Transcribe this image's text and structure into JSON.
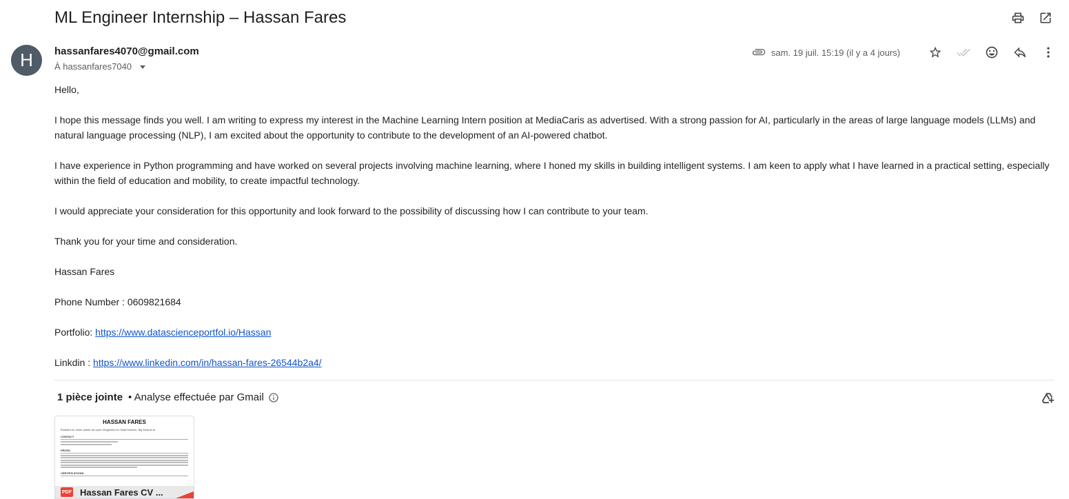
{
  "email": {
    "subject": "ML Engineer Internship – Hassan Fares",
    "avatar_letter": "H",
    "sender": "hassanfares4070@gmail.com",
    "recipient": "À hassanfares7040",
    "date": "sam. 19 juil. 15:19 (il y a 4 jours)",
    "body": {
      "greeting": "Hello,",
      "p1": "I hope this message finds you well. I am writing to express my interest in the Machine Learning Intern position at MediaCaris as advertised. With a strong passion for AI, particularly in the areas of large language models (LLMs) and natural language processing (NLP), I am excited about the opportunity to contribute to the development of an AI-powered chatbot.",
      "p2": "I have experience in Python programming and have worked on several projects involving machine learning, where I honed my skills in building intelligent systems. I am keen to apply what I have learned in a practical setting, especially within the field of education and mobility, to create impactful technology.",
      "p3": "I would appreciate your consideration for this opportunity and look forward to the possibility of discussing how I can contribute to your team.",
      "p4": "Thank you for your time and consideration.",
      "name": "Hassan Fares",
      "phone": "Phone Number : 0609821684",
      "portfolio_label": "Portfolio: ",
      "portfolio_url": "https://www.datascienceportfol.io/Hassan",
      "linkedin_label": "Linkdin : ",
      "linkedin_url": "https://www.linkedin.com/in/hassan-fares-26544b2a4/"
    }
  },
  "attachments": {
    "count_label": "1 pièce jointe",
    "scan_label": "• Analyse effectuée par Gmail",
    "file": {
      "name": "Hassan Fares CV ...",
      "type_badge": "PDF",
      "thumb_title": "HASSAN FARES",
      "thumb_subtitle": "Étudiant en 2ème année de cycle d'ingénieur en Data Science, Big Data et AI",
      "thumb_contact": "CONTACT",
      "thumb_profile": "PROFIL",
      "thumb_certs": "CERTIFICATIONS"
    }
  },
  "icons": {
    "print": "print-icon",
    "open_new_window": "open-in-new-icon",
    "attachment": "paperclip-icon",
    "star": "star-icon",
    "read_receipt": "double-check-icon",
    "emoji": "emoji-icon",
    "reply": "reply-icon",
    "more": "more-vert-icon",
    "info": "info-icon",
    "drive": "add-to-drive-icon"
  }
}
